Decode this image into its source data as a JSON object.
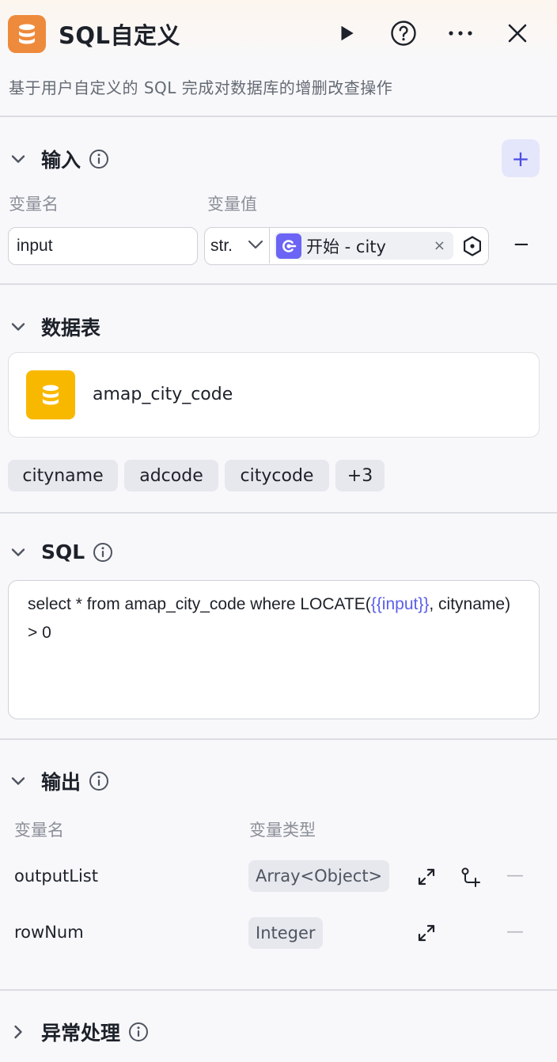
{
  "header": {
    "title": "SQL自定义",
    "subtitle": "基于用户自定义的 SQL 完成对数据库的增删改查操作",
    "icons": [
      "database-icon",
      "play-icon",
      "help-icon",
      "more-icon",
      "close-icon"
    ]
  },
  "input_section": {
    "title": "输入",
    "col_name": "变量名",
    "col_value": "变量值",
    "variable": {
      "name": "input",
      "type": "str.",
      "ref_text": "开始 - city",
      "ref_close": "×"
    },
    "add_label": "+",
    "remove_label": "−"
  },
  "table_section": {
    "title": "数据表",
    "table_name": "amap_city_code",
    "columns": [
      "cityname",
      "adcode",
      "citycode",
      "+3"
    ]
  },
  "sql_section": {
    "title": "SQL",
    "sql_before": "select * from amap_city_code where LOCATE(",
    "sql_var": "{{input}}",
    "sql_after": ", cityname) > 0"
  },
  "output_section": {
    "title": "输出",
    "col_name": "变量名",
    "col_type": "变量类型",
    "rows": [
      {
        "name": "outputList",
        "type": "Array<Object>",
        "remove": "—"
      },
      {
        "name": "rowNum",
        "type": "Integer",
        "remove": "—"
      }
    ]
  },
  "error_section": {
    "title": "异常处理"
  },
  "colors": {
    "accent": "#4c4fe2",
    "app_icon": "#ee8a3c",
    "table_icon": "#f9b800",
    "ref_icon": "#6b64f5"
  }
}
